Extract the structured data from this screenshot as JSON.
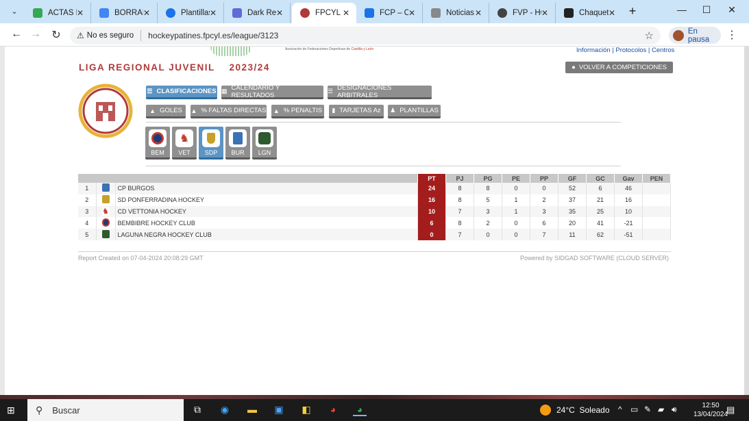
{
  "browser": {
    "tabs": [
      {
        "label": "ACTAS PA",
        "color": "#34a853"
      },
      {
        "label": "BORRAD",
        "color": "#4285f4"
      },
      {
        "label": "Plantillas",
        "color": "#1a73e8"
      },
      {
        "label": "Dark Red",
        "color": "#5f6bd6"
      },
      {
        "label": "FPCYL - H",
        "color": "#b03a3a"
      },
      {
        "label": "FCP – Co",
        "color": "#1a73e8"
      },
      {
        "label": "Noticias",
        "color": "#888888"
      },
      {
        "label": "FVP - HC",
        "color": "#444444"
      },
      {
        "label": "Chaqueta",
        "color": "#222222"
      }
    ],
    "security_label": "No es seguro",
    "url": "hockeypatines.fpcyl.es/league/3123",
    "profile_label": "En pausa"
  },
  "page": {
    "top_links": "Información | Protocolos | Centros",
    "federation_text_1": "Asociación de Federaciones Deportivas de ",
    "federation_text_2": "Castilla y León",
    "league_title": "LIGA REGIONAL JUVENIL    2023/24",
    "back_button": "VOLVER A COMPETICIONES",
    "nav_primary": [
      "CLASIFICACIONES",
      "CALENDARIO Y RESULTADOS",
      "DESIGNACIONES ARBITRALES"
    ],
    "nav_secondary": [
      "GOLES",
      "% FALTAS DIRECTAS",
      "% PENALTIS",
      "TARJETAS Az",
      "PLANTILLAS"
    ],
    "team_tiles": [
      "BEM",
      "VET",
      "SDP",
      "BUR",
      "LGN"
    ],
    "table": {
      "headers": [
        "PT",
        "PJ",
        "PG",
        "PE",
        "PP",
        "GF",
        "GC",
        "Gav",
        "PEN"
      ],
      "rows": [
        {
          "pos": "1",
          "team": "CP BURGOS",
          "pt": "24",
          "pj": "8",
          "pg": "8",
          "pe": "0",
          "pp": "0",
          "gf": "52",
          "gc": "6",
          "gav": "46",
          "pen": ""
        },
        {
          "pos": "2",
          "team": "SD PONFERRADINA HOCKEY",
          "pt": "16",
          "pj": "8",
          "pg": "5",
          "pe": "1",
          "pp": "2",
          "gf": "37",
          "gc": "21",
          "gav": "16",
          "pen": ""
        },
        {
          "pos": "3",
          "team": "CD VETTONIA HOCKEY",
          "pt": "10",
          "pj": "7",
          "pg": "3",
          "pe": "1",
          "pp": "3",
          "gf": "35",
          "gc": "25",
          "gav": "10",
          "pen": ""
        },
        {
          "pos": "4",
          "team": "BEMBIBRE HOCKEY CLUB",
          "pt": "6",
          "pj": "8",
          "pg": "2",
          "pe": "0",
          "pp": "6",
          "gf": "20",
          "gc": "41",
          "gav": "-21",
          "pen": ""
        },
        {
          "pos": "5",
          "team": "LAGUNA NEGRA HOCKEY CLUB",
          "pt": "0",
          "pj": "7",
          "pg": "0",
          "pe": "0",
          "pp": "7",
          "gf": "11",
          "gc": "62",
          "gav": "-51",
          "pen": ""
        }
      ]
    },
    "footer_left": "Report Created on 07-04-2024 20:08:29 GMT",
    "footer_right": "Powered by SIDGAD SOFTWARE (CLOUD SERVER)"
  },
  "taskbar": {
    "search_label": "Buscar",
    "weather": "24°C  Soleado",
    "time": "12:50",
    "date": "13/04/2024"
  },
  "colors": {
    "accent_red": "#a41d1d",
    "button_gray": "#8f8f8f",
    "button_active": "#5c94c4",
    "tab_strip": "#cce4f7"
  }
}
